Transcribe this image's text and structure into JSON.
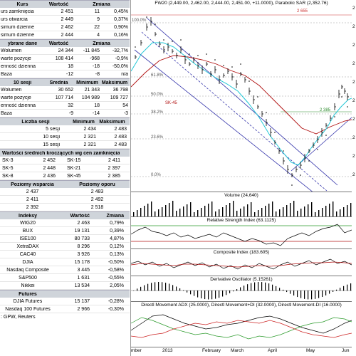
{
  "session": {
    "headers": [
      "Kurs",
      "Wartość",
      "Zmiana"
    ],
    "rows": [
      {
        "label": "urs zamknięcia",
        "value": "2 451",
        "change": "11",
        "pct": "0,45%"
      },
      {
        "label": "urs otwarcia",
        "value": "2 449",
        "change": "9",
        "pct": "0,37%"
      },
      {
        "label": "simum dzienne",
        "value": "2 462",
        "change": "22",
        "pct": "0,90%"
      },
      {
        "label": "simum dzienne",
        "value": "2 444",
        "change": "4",
        "pct": "0,16%"
      }
    ]
  },
  "selected": {
    "headers": [
      "ybrane dane",
      "Wartość",
      "Zmiana"
    ],
    "rows": [
      {
        "label": "Wolumen",
        "value": "24 344",
        "change": "-11 845",
        "pct": "-32,7%"
      },
      {
        "label": "warte pozycje",
        "value": "108 414",
        "change": "-968",
        "pct": "-0,9%"
      },
      {
        "label": "enność dzienna",
        "value": "18",
        "change": "-18",
        "pct": "-50,0%"
      },
      {
        "label": "Baza",
        "value": "-12",
        "change": "-8",
        "pct": "n/a"
      }
    ]
  },
  "ten": {
    "headers": [
      "10 sesji",
      "Średnia",
      "Minimum",
      "Maksimum"
    ],
    "rows": [
      {
        "label": "Wolumen",
        "avg": "30 652",
        "min": "21 343",
        "max": "36 798"
      },
      {
        "label": "warte pozycje",
        "avg": "107 714",
        "min": "104 989",
        "max": "109 727"
      },
      {
        "label": "enność dzienna",
        "avg": "32",
        "min": "18",
        "max": "54"
      },
      {
        "label": "Baza",
        "avg": "-9",
        "min": "-14",
        "max": "-3"
      }
    ]
  },
  "range": {
    "headers": [
      "Liczba sesji",
      "Minimum",
      "Maksimum"
    ],
    "rows": [
      {
        "label": "5 sesji",
        "min": "2 434",
        "max": "2 483"
      },
      {
        "label": "10 sesji",
        "min": "2 321",
        "max": "2 483"
      },
      {
        "label": "15 sesji",
        "min": "2 321",
        "max": "2 483"
      }
    ]
  },
  "ma": {
    "header": "Wartości średnich kroczących wg cen zamknięcia",
    "rows": [
      [
        {
          "label": "SK-3",
          "value": "2 452"
        },
        {
          "label": "SK-15",
          "value": "2 411"
        }
      ],
      [
        {
          "label": "SK-5",
          "value": "2 448"
        },
        {
          "label": "SK-21",
          "value": "2 397"
        }
      ],
      [
        {
          "label": "SK-8",
          "value": "2 436"
        },
        {
          "label": "SK-45",
          "value": "2 385"
        }
      ]
    ]
  },
  "levels": {
    "headers": [
      "Poziomy wsparcia",
      "Poziomy oporu"
    ],
    "rows": [
      [
        "2 437",
        "2 483"
      ],
      [
        "2 411",
        "2 492"
      ],
      [
        "2 392",
        "2 518"
      ]
    ]
  },
  "indices": {
    "headers": [
      "Indeksy",
      "Wartość",
      "Zmiana"
    ],
    "rows": [
      {
        "name": "WIG20",
        "value": "2 463",
        "change": "0,79%"
      },
      {
        "name": "BUX",
        "value": "19 131",
        "change": "0,39%"
      },
      {
        "name": "ISE100",
        "value": "80 733",
        "change": "4,87%"
      },
      {
        "name": "XetraDAX",
        "value": "8 296",
        "change": "0,12%"
      },
      {
        "name": "CAC40",
        "value": "3 926",
        "change": "0,13%"
      },
      {
        "name": "DJIA",
        "value": "15 178",
        "change": "-0,50%"
      },
      {
        "name": "Nasdaq Composite",
        "value": "3 445",
        "change": "-0,58%"
      },
      {
        "name": "S&P500",
        "value": "1 631",
        "change": "-0,55%"
      },
      {
        "name": "Nikkei",
        "value": "13 534",
        "change": "2,05%"
      }
    ]
  },
  "futures": {
    "headers": [
      "Futures",
      "",
      ""
    ],
    "rows": [
      {
        "name": "DJIA Futures",
        "value": "15 137",
        "change": "-0,28%"
      },
      {
        "name": "Nasdaq 100 Futures",
        "value": "2 966",
        "change": "-0,30%"
      }
    ]
  },
  "source": ": GPW, Reuters",
  "chart": {
    "price_title": "FW20 (2,449.00, 2,462.00, 2,444.00, 2,451.00, +11.0000), Parabolic SAR (2,352.76)",
    "fib_labels": [
      "100.0%",
      "61.8%",
      "50.0%",
      "38.2%",
      "23.6%",
      "0.0%"
    ],
    "tag_top": "2 655",
    "tag_mid": "2 385",
    "tag_ma": "SK-45",
    "volume_title": "Volume (24,640)",
    "rsi_title": "Relative Strength Index (63.1125)",
    "composite_title": "Composite Index (183.605)",
    "deriv_title": "Derivative Oscillator (5.15261)",
    "adx_title": "Directl Movement ADX (25.0000), Directl Movement+DI (32.0000), Directl Movement-DI (16.0000)",
    "x_labels": [
      "mber",
      "2013",
      "February",
      "March",
      "April",
      "May",
      "Jun"
    ],
    "right_ticks": [
      "2",
      "2",
      "2",
      "2",
      "2",
      "2",
      "2",
      "2",
      "2",
      "2"
    ],
    "colors": {
      "price": "#000000",
      "ma_red": "#b01010",
      "ma_cyan": "#22c7d6",
      "channel": "#3333aa",
      "rsi_ref": "#2a9a2a",
      "fib": "#999999"
    }
  }
}
